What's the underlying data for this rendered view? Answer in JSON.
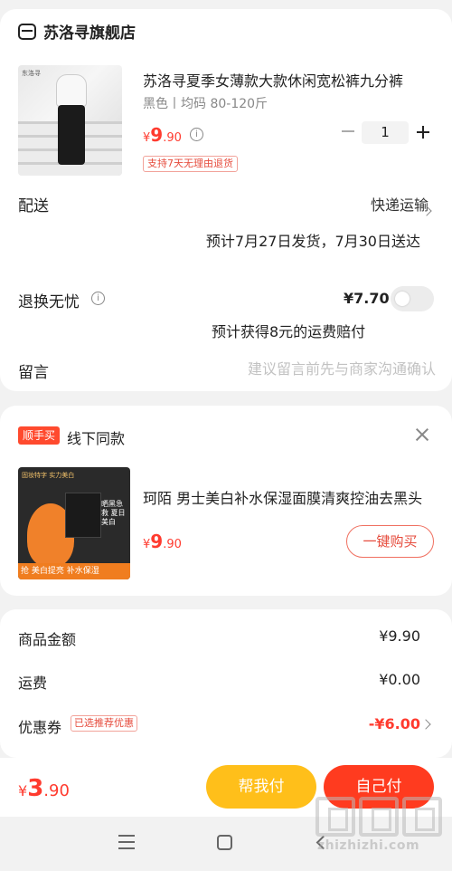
{
  "store": {
    "name": "苏洛寻旗舰店",
    "icon": "store-icon"
  },
  "product": {
    "image_mark": "东洛寻",
    "title": "苏洛寻夏季女薄款大款休闲宽松裤九分裤",
    "spec": "黑色丨均码 80-120斤",
    "price_symbol": "¥",
    "price_int": "9",
    "price_dec": ".90",
    "quantity": "1",
    "return_tag": "支持7天无理由退货"
  },
  "shipping": {
    "label": "配送",
    "method": "快递运输",
    "eta": "预计7月27日发货，7月30日送达"
  },
  "return_insurance": {
    "label": "退换无忧",
    "price": "¥7.70",
    "enabled": false,
    "note": "预计获得8元的运费赔付"
  },
  "message": {
    "label": "留言",
    "placeholder": "建议留言前先与商家沟通确认"
  },
  "promo": {
    "tag": "顺手买",
    "title": "线下同款",
    "image_text_top": "固妆特字 实力美白",
    "image_text_right": "晒黑急救 夏日美白",
    "image_band": "抢 美白提亮 补水保湿",
    "product_name": "珂陌 男士美白补水保湿面膜清爽控油去黑头",
    "price_symbol": "¥",
    "price_int": "9",
    "price_dec": ".90",
    "buy_label": "一键购买"
  },
  "summary": {
    "goods_label": "商品金额",
    "goods_value": "¥9.90",
    "shipping_label": "运费",
    "shipping_value": "¥0.00",
    "coupon_label": "优惠券",
    "coupon_tag": "已选推荐优惠",
    "coupon_value": "-¥6.00"
  },
  "footer": {
    "total_symbol": "¥",
    "total_int": "3",
    "total_dec": ".90",
    "help_pay_label": "帮我付",
    "self_pay_label": "自己付"
  },
  "watermark": {
    "text": "zhizhizhi.com"
  },
  "colors": {
    "accent": "#ff3b2f",
    "help_button": "#ffbf1a",
    "pay_button": "#ff3b1f"
  }
}
